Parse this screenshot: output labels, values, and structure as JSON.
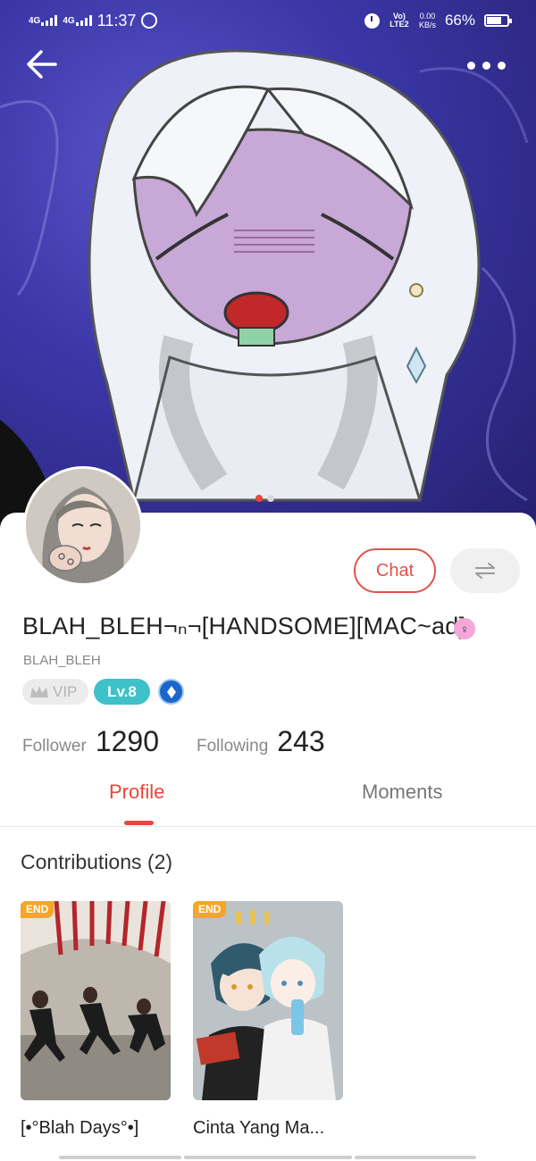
{
  "status_bar": {
    "network_1": "4G",
    "network_2": "4G",
    "time": "11:37",
    "volte": "Vo) LTE2",
    "speed_value": "0.00",
    "speed_unit": "KB/s",
    "battery": "66%",
    "battery_level": 0.66
  },
  "hero": {
    "banner_page_index": 0,
    "banner_page_count": 2
  },
  "profile": {
    "chat_label": "Chat",
    "display_name": "BLAH_BLEH¬ₙ¬[HANDSOME][MAC~ad]",
    "gender_symbol": "♀",
    "handle": "BLAH_BLEH",
    "vip_label": "VIP",
    "level_label": "Lv.8"
  },
  "stats": {
    "follower_label": "Follower",
    "follower_count": "1290",
    "following_label": "Following",
    "following_count": "243"
  },
  "tabs": {
    "profile": "Profile",
    "moments": "Moments",
    "active": "Profile"
  },
  "contributions": {
    "title": "Contributions (2)",
    "items": [
      {
        "badge": "END",
        "title": "[•°Blah Days°•]"
      },
      {
        "badge": "END",
        "title": "Cinta Yang Ma..."
      }
    ]
  },
  "colors": {
    "accent": "#e8453c",
    "level_badge": "#3ec1c8",
    "end_badge": "#f5a623"
  }
}
